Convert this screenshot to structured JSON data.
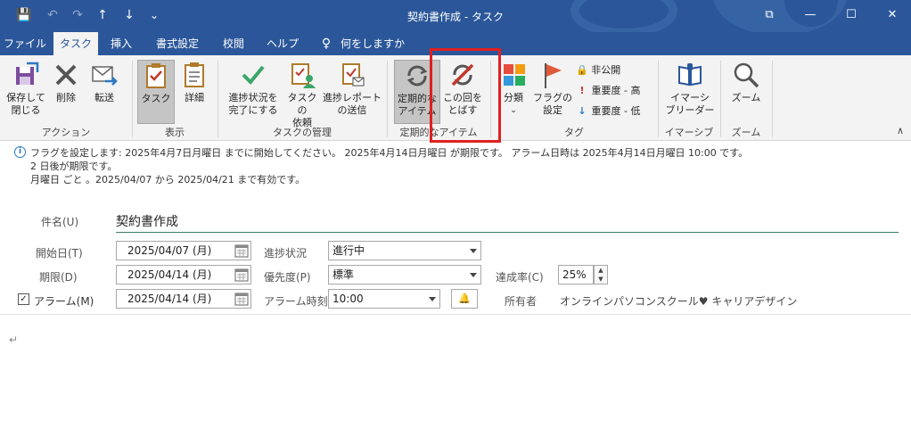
{
  "window": {
    "title": "契約書作成 - タスク",
    "qa_save": "💾",
    "qa_undo": "↶",
    "qa_redo": "↷",
    "qa_up": "↑",
    "qa_down": "↓",
    "qa_customize": "⌄",
    "btn_restore": "⧉",
    "btn_minimize": "—",
    "btn_maximize": "☐",
    "btn_close": "✕"
  },
  "tabs": {
    "file": "ファイル",
    "task": "タスク",
    "insert": "挿入",
    "format": "書式設定",
    "review": "校閲",
    "help": "ヘルプ",
    "tellme": "何をしますか"
  },
  "ribbon": {
    "actions": {
      "save_close_1": "保存して",
      "save_close_2": "閉じる",
      "delete": "削除",
      "forward": "転送",
      "group": "アクション"
    },
    "show": {
      "task": "タスク",
      "details": "詳細",
      "group": "表示"
    },
    "manage": {
      "complete_1": "進捗状況を",
      "complete_2": "完了にする",
      "assign_1": "タスクの",
      "assign_2": "依頼",
      "report_1": "進捗レポート",
      "report_2": "の送信",
      "group": "タスクの管理"
    },
    "recurrence": {
      "recurring_1": "定期的な",
      "recurring_2": "アイテム",
      "skip_1": "この回を",
      "skip_2": "とばす",
      "group": "定期的なアイテム"
    },
    "tags": {
      "categorize": "分類",
      "flag_1": "フラグの",
      "flag_2": "設定",
      "private": "非公開",
      "high": "重要度 - 高",
      "low": "重要度 - 低",
      "group": "タグ"
    },
    "immersive": {
      "reader_1": "イマーシ",
      "reader_2": "ブリーダー",
      "group": "イマーシブ"
    },
    "zoom": {
      "zoom": "ズーム",
      "group": "ズーム"
    }
  },
  "info": {
    "line1": "フラグを設定します: 2025年4月7日月曜日 までに開始してください。 2025年4月14日月曜日 が期限です。 アラーム日時は 2025年4月14日月曜日 10:00 です。",
    "line2": "2 日後が期限です。",
    "line3": "月曜日 ごと 。2025/04/07 から 2025/04/21 まで有効です。"
  },
  "form": {
    "subject_label": "件名(U)",
    "subject": "契約書作成",
    "start_label": "開始日(T)",
    "start": "2025/04/07 (月)",
    "due_label": "期限(D)",
    "due": "2025/04/14 (月)",
    "alarm_label": "アラーム(M)",
    "alarm_date": "2025/04/14 (月)",
    "alarm_checked": "✓",
    "status_label": "進捗状況",
    "status": "進行中",
    "priority_label": "優先度(P)",
    "priority": "標準",
    "alarm_time_label": "アラーム時刻",
    "alarm_time": "10:00",
    "complete_label": "達成率(C)",
    "complete": "25%",
    "owner_label": "所有者",
    "owner": "オンラインパソコンスクール♥ キャリアデザイン",
    "paragraph_mark": "↵"
  },
  "icons": {
    "info": "i",
    "bell": "🔔",
    "collapse": "∧",
    "spin_up": "▲",
    "spin_down": "▼",
    "tellme": "♀"
  }
}
